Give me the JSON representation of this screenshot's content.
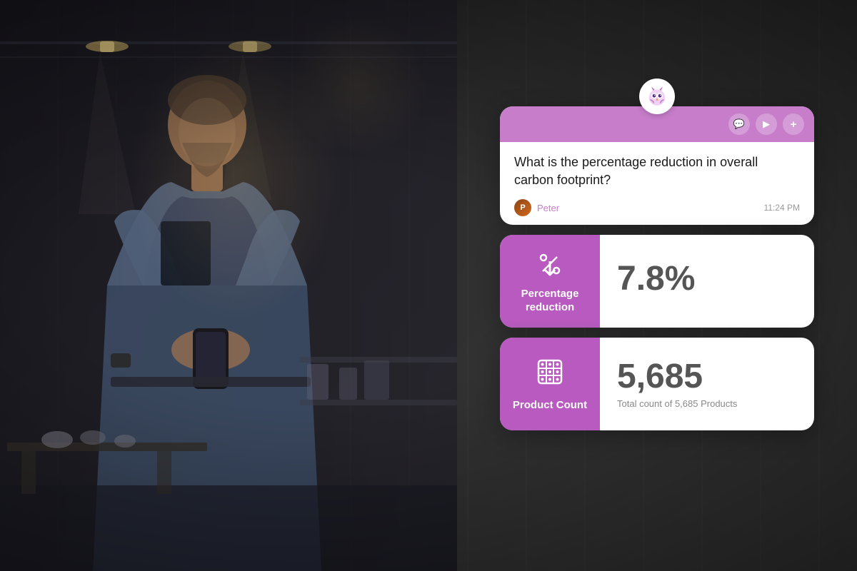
{
  "background": {
    "color": "#1a1a1a"
  },
  "app_logo": {
    "icon": "🦉",
    "alt": "Owl AI assistant"
  },
  "chat_card": {
    "header_color": "#c77dca",
    "icons": [
      {
        "name": "chat-icon",
        "symbol": "💬"
      },
      {
        "name": "play-icon",
        "symbol": "▶"
      },
      {
        "name": "add-icon",
        "symbol": "+"
      }
    ],
    "question": "What is the percentage reduction in overall carbon footprint?",
    "user": {
      "name": "Peter",
      "initials": "P",
      "avatar_color": "#8B4513"
    },
    "timestamp": "11:24 PM"
  },
  "metrics": [
    {
      "id": "percentage-reduction",
      "icon": "%↓",
      "label": "Percentage reduction",
      "value": "7.8%",
      "description": "",
      "label_bg": "#b85abf"
    },
    {
      "id": "product-count",
      "icon": "⊞",
      "label": "Product Count",
      "value": "5,685",
      "description": "Total count of 5,685 Products",
      "label_bg": "#b85abf"
    }
  ]
}
